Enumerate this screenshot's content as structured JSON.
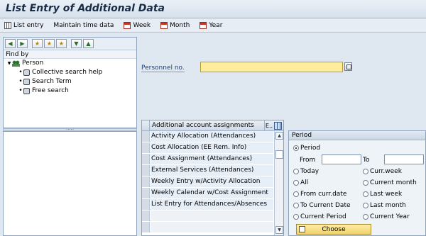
{
  "window": {
    "title": "List Entry of Additional Data"
  },
  "toolbar": {
    "list_entry": "List entry",
    "maintain_time_data": "Maintain time data",
    "week": "Week",
    "month": "Month",
    "year": "Year"
  },
  "left_panel": {
    "find_by": "Find by",
    "root": "Person",
    "items": [
      "Collective search help",
      "Search Term",
      "Free search"
    ]
  },
  "form": {
    "personnel_no_label": "Personnel no.",
    "personnel_no_value": ""
  },
  "accounts_table": {
    "header": "Additional account assignments",
    "col_e": "E..",
    "rows": [
      "Activity Allocation (Attendances)",
      "Cost Allocation (EE Rem. Info)",
      "Cost Assignment (Attendances)",
      "External Services (Attendances)",
      "Weekly Entry w/Activity Allocation",
      "Weekly Calendar w/Cost Assignment",
      "List Entry for Attendances/Absences"
    ]
  },
  "period": {
    "title": "Period",
    "period_option": "Period",
    "from_label": "From",
    "to_label": "To",
    "options_left": [
      "Today",
      "All",
      "From curr.date",
      "To Current Date",
      "Current Period"
    ],
    "options_right": [
      "Curr.week",
      "Current month",
      "Last week",
      "Last month",
      "Current Year"
    ],
    "choose": "Choose",
    "selected": "Period"
  },
  "colors": {
    "required_field": "#ffed9e",
    "label_blue": "#1c3f7d",
    "row_bg": "#e6eef7"
  }
}
